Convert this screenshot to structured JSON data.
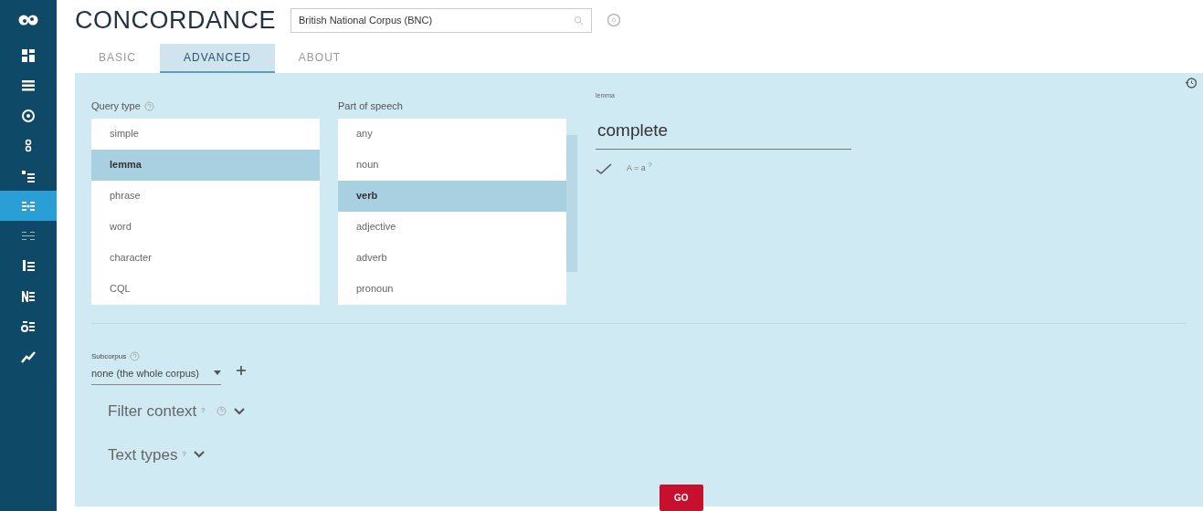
{
  "sidebar": {
    "items": [
      {
        "selected": false
      },
      {
        "selected": false
      },
      {
        "selected": false
      },
      {
        "selected": false
      },
      {
        "selected": false
      },
      {
        "selected": true
      },
      {
        "selected": false
      },
      {
        "selected": false
      },
      {
        "selected": false
      },
      {
        "selected": false
      },
      {
        "selected": false
      }
    ]
  },
  "header": {
    "title": "CONCORDANCE",
    "corpus": "British National Corpus (BNC)"
  },
  "tabs": [
    {
      "label": "BASIC",
      "selected": false
    },
    {
      "label": "ADVANCED",
      "selected": true
    },
    {
      "label": "ABOUT",
      "selected": false
    }
  ],
  "query_type": {
    "label": "Query type",
    "options": [
      {
        "label": "simple",
        "selected": false
      },
      {
        "label": "lemma",
        "selected": true
      },
      {
        "label": "phrase",
        "selected": false
      },
      {
        "label": "word",
        "selected": false
      },
      {
        "label": "character",
        "selected": false
      },
      {
        "label": "CQL",
        "selected": false
      }
    ]
  },
  "part_of_speech": {
    "label": "Part of speech",
    "options": [
      {
        "label": "any",
        "selected": false
      },
      {
        "label": "noun",
        "selected": false
      },
      {
        "label": "verb",
        "selected": true
      },
      {
        "label": "adjective",
        "selected": false
      },
      {
        "label": "adverb",
        "selected": false
      },
      {
        "label": "pronoun",
        "selected": false
      }
    ]
  },
  "lemma": {
    "label": "lemma",
    "value": "complete",
    "match_case": {
      "label": "A = a",
      "mark": "?",
      "checked": true
    }
  },
  "subcorpus": {
    "label": "Subcorpus",
    "value": "none (the whole corpus)"
  },
  "sections": [
    {
      "label": "Filter context",
      "mark": "?",
      "help": true
    },
    {
      "label": "Text types",
      "mark": "?",
      "help": false
    }
  ],
  "go_button": "GO"
}
